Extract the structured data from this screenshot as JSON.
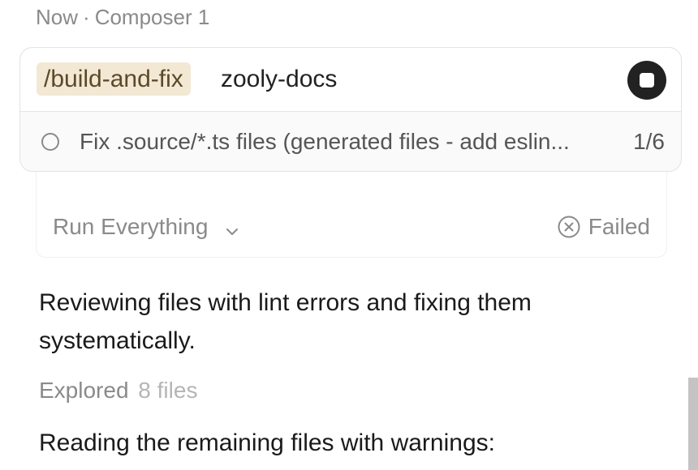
{
  "header": {
    "time": "Now",
    "separator": "·",
    "composer_name": "Composer 1"
  },
  "composer": {
    "command_chip": "/build-and-fix",
    "query": "zooly-docs",
    "stop_icon": "stop-icon"
  },
  "todo": {
    "text": "Fix .source/*.ts files (generated files - add eslin...",
    "count": "1/6"
  },
  "run": {
    "label": "Run Everything",
    "status": "Failed"
  },
  "messages": {
    "reviewing": "Reviewing files with lint errors and fixing them systematically.",
    "explored_label": "Explored",
    "explored_count": "8 files",
    "reading": "Reading the remaining files with warnings:"
  },
  "colors": {
    "chip_bg": "#f3e8d4",
    "stop_button": "#222222",
    "muted_text": "#8a8a8a"
  }
}
